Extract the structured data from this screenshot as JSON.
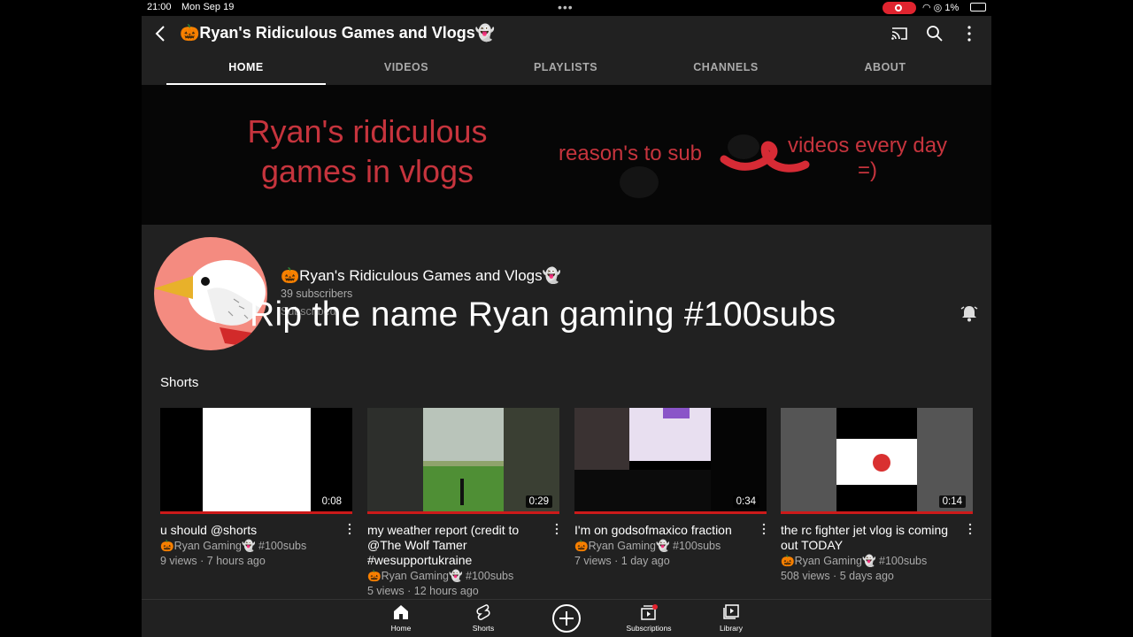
{
  "status": {
    "time": "21:00",
    "date": "Mon Sep 19",
    "battery": "1%"
  },
  "header": {
    "title": "🎃Ryan's Ridiculous Games and Vlogs👻"
  },
  "tabs": [
    {
      "label": "HOME",
      "active": true
    },
    {
      "label": "VIDEOS"
    },
    {
      "label": "PLAYLISTS"
    },
    {
      "label": "CHANNELS"
    },
    {
      "label": "ABOUT"
    }
  ],
  "banner": {
    "main_line1": "Ryan's ridiculous",
    "main_line2": "games in vlogs",
    "reason": "reason's to sub",
    "every_line1": "videos every day",
    "every_line2": "=)"
  },
  "channel": {
    "name": "🎃Ryan's Ridiculous Games and Vlogs👻",
    "subscribers": "39 subscribers",
    "subscribe_label": "Subscribed",
    "overlay": "Rip the name Ryan gaming #100subs"
  },
  "shorts": {
    "heading": "Shorts",
    "items": [
      {
        "duration": "0:08",
        "title": "u should @shorts",
        "channel": "🎃Ryan Gaming👻 #100subs",
        "meta": "9 views · 7 hours ago"
      },
      {
        "duration": "0:29",
        "title": "my weather report (credit to @The Wolf Tamer #wesupportukraine",
        "channel": "🎃Ryan Gaming👻 #100subs",
        "meta": "5 views · 12 hours ago"
      },
      {
        "duration": "0:34",
        "title": "I'm on godsofmaxico fraction",
        "channel": "🎃Ryan Gaming👻 #100subs",
        "meta": "7 views · 1 day ago"
      },
      {
        "duration": "0:14",
        "title": "the rc fighter jet vlog is coming out TODAY",
        "channel": "🎃Ryan Gaming👻 #100subs",
        "meta": "508 views · 5 days ago"
      }
    ]
  },
  "bottom_nav": [
    {
      "label": "Home",
      "icon": "home-icon"
    },
    {
      "label": "Shorts",
      "icon": "shorts-icon"
    },
    {
      "label": "Subscriptions",
      "icon": "subscriptions-icon"
    },
    {
      "label": "Library",
      "icon": "library-icon"
    }
  ],
  "colors": {
    "accent_red": "#cc1a1a",
    "banner_text": "#c6343d",
    "background": "#212121"
  }
}
